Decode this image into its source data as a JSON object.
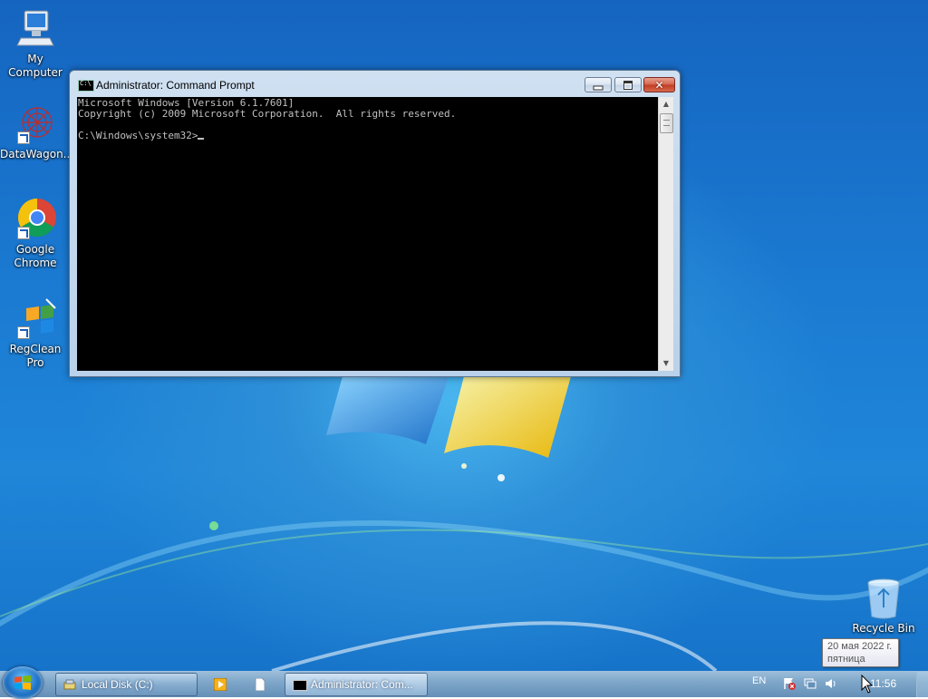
{
  "desktop": {
    "icons": [
      {
        "label": "My Computer",
        "icon": "computer-icon"
      },
      {
        "label": "DataWagon...",
        "icon": "datawagon-icon"
      },
      {
        "label": "Google Chrome",
        "icon": "chrome-icon"
      },
      {
        "label": "RegClean Pro",
        "icon": "regclean-icon"
      },
      {
        "label": "Recycle Bin",
        "icon": "recycle-bin-icon"
      }
    ]
  },
  "window": {
    "title": "Administrator: Command Prompt",
    "close_glyph": "✕",
    "console_lines": [
      "Microsoft Windows [Version 6.1.7601]",
      "Copyright (c) 2009 Microsoft Corporation.  All rights reserved.",
      "",
      "C:\\Windows\\system32>"
    ]
  },
  "taskbar": {
    "buttons": [
      {
        "label": "Local Disk (C:)",
        "icon": "folder-icon"
      },
      {
        "label": "",
        "icon": "media-player-icon"
      },
      {
        "label": "",
        "icon": "document-icon"
      },
      {
        "label": "Administrator: Com...",
        "icon": "cmd-icon"
      }
    ],
    "language": "EN",
    "tray_icons": [
      "action-center-icon",
      "network-icon",
      "volume-icon"
    ],
    "clock": "11:56",
    "tooltip": {
      "date": "20 мая 2022 г.",
      "weekday": "пятница"
    }
  },
  "colors": {
    "desktop_blue": "#1b7bd2",
    "console_bg": "#000000",
    "console_fg": "#c0c0c0",
    "close_red": "#c13b22"
  }
}
